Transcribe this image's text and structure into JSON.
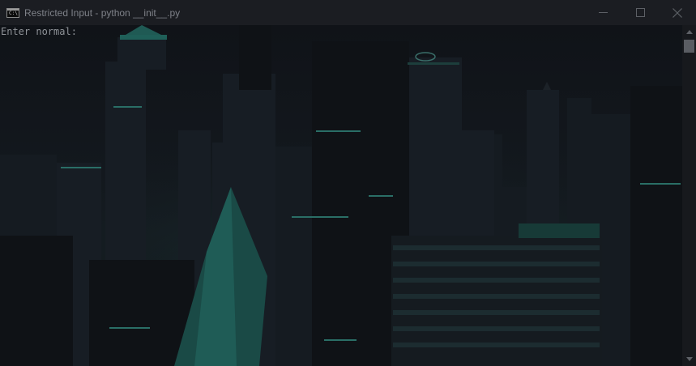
{
  "window": {
    "title": "Restricted Input - python  __init__.py",
    "icon": "console-icon",
    "icon_glyph": "C:\\",
    "controls": {
      "minimize": "minimize-icon",
      "maximize": "maximize-icon",
      "close": "close-icon"
    }
  },
  "console": {
    "prompt_line": "Enter normal:",
    "background": "city-skyline-wallpaper"
  },
  "scrollbar": {
    "up": "scroll-up-arrow",
    "down": "scroll-down-arrow"
  },
  "colors": {
    "titlebar_bg": "#1b1d22",
    "title_text": "#7e8188",
    "console_text": "#8e9297",
    "teal_accent": "#1f6f66"
  }
}
